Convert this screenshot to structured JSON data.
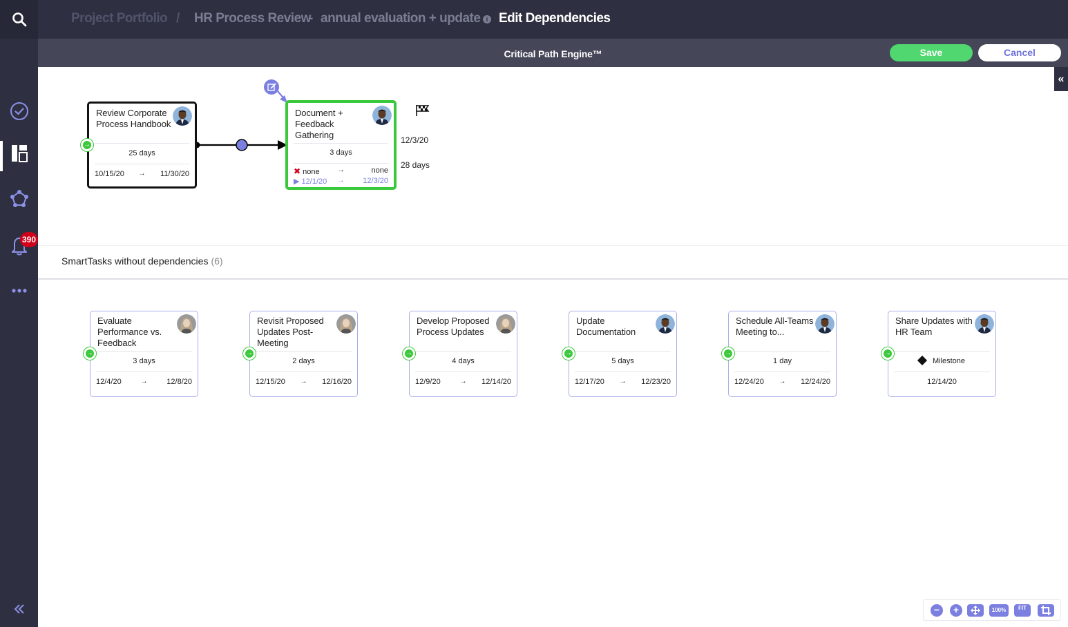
{
  "header": {
    "breadcrumb_root": "Project Portfolio",
    "breadcrumb_sep": "/",
    "project_name": "HR Process Review",
    "project_dash": "-",
    "project_suffix": "annual evaluation + update",
    "page_title": "Edit Dependencies"
  },
  "toolbar": {
    "engine_label": "Critical Path Engine™",
    "save_label": "Save",
    "cancel_label": "Cancel"
  },
  "sidebar": {
    "items": [
      {
        "icon": "search-icon"
      },
      {
        "icon": "check-circle-icon"
      },
      {
        "icon": "board-icon"
      },
      {
        "icon": "network-icon"
      },
      {
        "icon": "bell-icon"
      },
      {
        "icon": "more-icon"
      }
    ],
    "notification_count": "390"
  },
  "dependency_chain": {
    "predecessor": {
      "title": "Review Corporate Process Handbook",
      "duration": "25 days",
      "start": "10/15/20",
      "end": "11/30/20",
      "arrow": "→"
    },
    "successor": {
      "title": "Document + Feedback Gathering",
      "duration": "3 days",
      "constraint_start": "none",
      "constraint_end": "none",
      "start": "12/1/20",
      "end": "12/3/20",
      "arrow": "→"
    },
    "finish_date": "12/3/20",
    "total_duration": "28 days"
  },
  "independent_section": {
    "label": "SmartTasks without dependencies",
    "count": "(6)"
  },
  "tasks": [
    {
      "title": "Evaluate Performance vs. Feedback",
      "duration": "3 days",
      "start": "12/4/20",
      "end": "12/8/20",
      "arrow": "→",
      "avatar": "woman"
    },
    {
      "title": "Revisit Proposed Updates Post-Meeting",
      "duration": "2 days",
      "start": "12/15/20",
      "end": "12/16/20",
      "arrow": "→",
      "avatar": "woman"
    },
    {
      "title": "Develop Proposed Process Updates",
      "duration": "4 days",
      "start": "12/9/20",
      "end": "12/14/20",
      "arrow": "→",
      "avatar": "woman"
    },
    {
      "title": "Update Documentation",
      "duration": "5 days",
      "start": "12/17/20",
      "end": "12/23/20",
      "arrow": "→",
      "avatar": "man"
    },
    {
      "title": "Schedule All-Teams Meeting to...",
      "duration": "1 day",
      "start": "12/24/20",
      "end": "12/24/20",
      "arrow": "→",
      "avatar": "man"
    },
    {
      "title": "Share Updates with HR Team",
      "milestone_label": "Milestone",
      "date": "12/14/20",
      "avatar": "man"
    }
  ],
  "zoom_controls": {
    "reset_label": "100%",
    "fit_label": "FIT"
  },
  "colors": {
    "sidebar_bg": "#2e3041",
    "accent": "#7b7fe0",
    "success": "#50d770",
    "selected_border": "#3cc83c",
    "badge": "#d0021b"
  }
}
